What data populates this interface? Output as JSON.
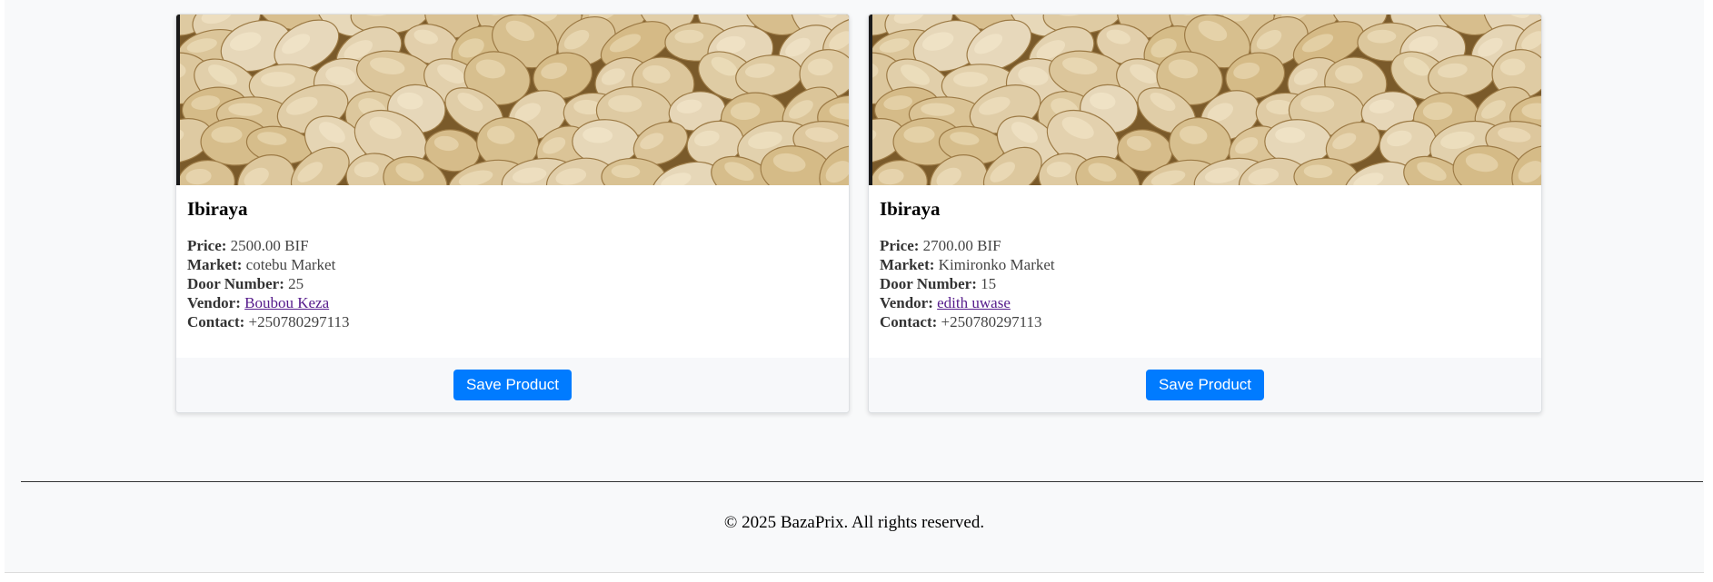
{
  "products": [
    {
      "name": "Ibiraya",
      "image_alt": "potatoes",
      "price_label": "Price:",
      "price": "2500.00 BIF",
      "market_label": "Market:",
      "market": "cotebu Market",
      "door_label": "Door Number:",
      "door": "25",
      "vendor_label": "Vendor:",
      "vendor": "Boubou Keza",
      "contact_label": "Contact:",
      "contact": "+250780297113",
      "button": "Save Product"
    },
    {
      "name": "Ibiraya",
      "image_alt": "potatoes",
      "price_label": "Price:",
      "price": "2700.00 BIF",
      "market_label": "Market:",
      "market": "Kimironko Market",
      "door_label": "Door Number:",
      "door": "15",
      "vendor_label": "Vendor:",
      "vendor": "edith uwase",
      "contact_label": "Contact:",
      "contact": "+250780297113",
      "button": "Save Product"
    }
  ],
  "footer": {
    "copyright": "© 2025 BazaPrix. All rights reserved."
  },
  "colors": {
    "primary": "#007bff",
    "visited_link": "#551a8b",
    "page_bg": "#f8f9fa"
  }
}
